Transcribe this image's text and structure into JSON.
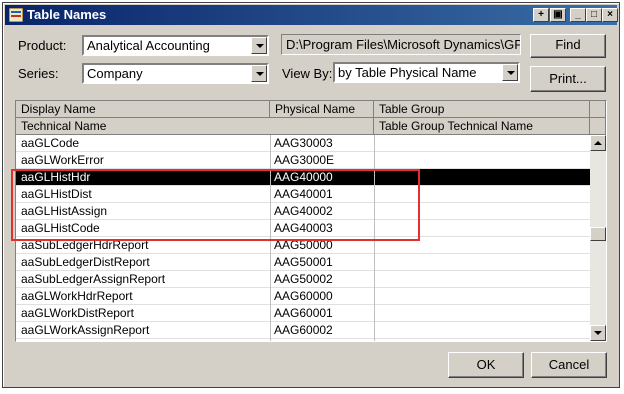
{
  "window": {
    "title": "Table Names"
  },
  "titlebar_buttons": [
    "pin",
    "restore",
    "minimize",
    "maximize",
    "close"
  ],
  "form": {
    "product_label": "Product:",
    "product_value": "Analytical Accounting",
    "series_label": "Series:",
    "series_value": "Company",
    "path_value": "D:\\Program Files\\Microsoft Dynamics\\GP$",
    "viewby_label": "View By:",
    "viewby_value": "by Table Physical Name",
    "find_label": "Find",
    "print_label": "Print..."
  },
  "grid": {
    "headers": {
      "display_name": "Display Name",
      "physical_name": "Physical Name",
      "table_group": "Table Group",
      "technical_name": "Technical Name",
      "table_group_technical_name": "Table Group Technical Name"
    },
    "rows": [
      {
        "display": "aaGLCode",
        "physical": "AAG30003"
      },
      {
        "display": "aaGLWorkError",
        "physical": "AAG3000E"
      },
      {
        "display": "aaGLHistHdr",
        "physical": "AAG40000",
        "selected": true
      },
      {
        "display": "aaGLHistDist",
        "physical": "AAG40001"
      },
      {
        "display": "aaGLHistAssign",
        "physical": "AAG40002"
      },
      {
        "display": "aaGLHistCode",
        "physical": "AAG40003"
      },
      {
        "display": "aaSubLedgerHdrReport",
        "physical": "AAG50000"
      },
      {
        "display": "aaSubLedgerDistReport",
        "physical": "AAG50001"
      },
      {
        "display": "aaSubLedgerAssignReport",
        "physical": "AAG50002"
      },
      {
        "display": "aaGLWorkHdrReport",
        "physical": "AAG60000"
      },
      {
        "display": "aaGLWorkDistReport",
        "physical": "AAG60001"
      },
      {
        "display": "aaGLWorkAssignReport",
        "physical": "AAG60002"
      }
    ]
  },
  "actions": {
    "ok_label": "OK",
    "cancel_label": "Cancel"
  },
  "colors": {
    "selection": "#000000",
    "highlight_box": "#e03030",
    "titlebar": "#0a246a"
  }
}
